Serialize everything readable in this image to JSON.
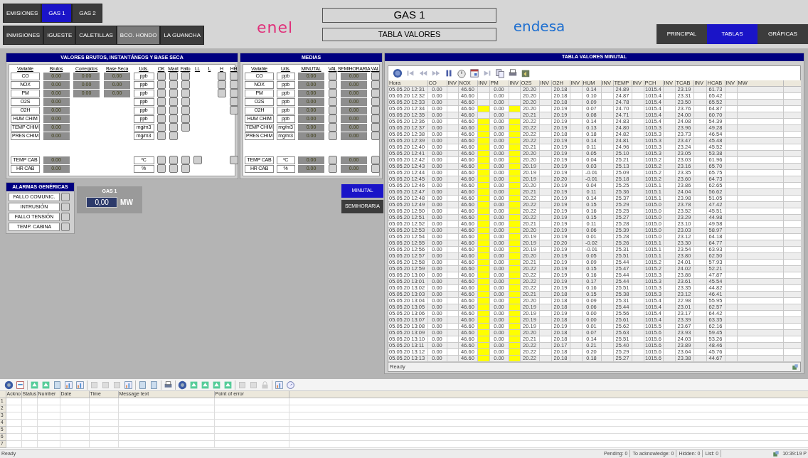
{
  "nav": {
    "row1": [
      {
        "label": "EMISIONES",
        "selected": false
      },
      {
        "label": "GAS 1",
        "selected": true
      },
      {
        "label": "GAS 2",
        "selected": false
      }
    ],
    "row2": [
      {
        "label": "INMISIONES",
        "selected": false
      },
      {
        "label": "IGUESTE",
        "selected": false
      },
      {
        "label": "CALETILLAS",
        "selected": false
      },
      {
        "label": "BCO. HONDO",
        "selected": true
      },
      {
        "label": "LA GUANCHA",
        "selected": false
      }
    ],
    "logo_left": "enel",
    "title": "GAS 1",
    "subtitle": "TABLA VALORES",
    "logo_right": "endesa",
    "right": [
      {
        "label": "PRINCIPAL",
        "selected": false
      },
      {
        "label": "TABLAS",
        "selected": true
      },
      {
        "label": "GRÁFICAS",
        "selected": false
      }
    ]
  },
  "raw_panel": {
    "title": "VALORES BRUTOS, INSTANTÁNEOS Y BASE SECA",
    "columns": [
      "Variable",
      "Brutos",
      "Corregidos",
      "Base Seca",
      "Uds.",
      "OK",
      "Mant",
      "Fallo",
      "LL",
      "L",
      "H",
      "HH"
    ],
    "rows": [
      {
        "variable": "CO",
        "brutos": "0.00",
        "corregidos": "0.00",
        "base_seca": "0.00",
        "units": "ppb",
        "boxes": [
          true,
          true,
          true,
          false,
          false,
          true,
          true
        ]
      },
      {
        "variable": "NOX",
        "brutos": "0.00",
        "corregidos": "0.00",
        "base_seca": "0.00",
        "units": "ppb",
        "boxes": [
          true,
          true,
          true,
          false,
          false,
          true,
          true
        ]
      },
      {
        "variable": "PM",
        "brutos": "0.00",
        "corregidos": "0.00",
        "base_seca": "0.00",
        "units": "ppb",
        "boxes": [
          true,
          true,
          true,
          false,
          false,
          true,
          true
        ]
      },
      {
        "variable": "O2S",
        "brutos": "0.00",
        "units": "ppb",
        "boxes": [
          true,
          true,
          true,
          false,
          false,
          false,
          true
        ]
      },
      {
        "variable": "O2H",
        "brutos": "0.00",
        "units": "ppb",
        "boxes": [
          true,
          true,
          true,
          false,
          false,
          false,
          true
        ]
      },
      {
        "variable": "HUM CHIM",
        "brutos": "0.00",
        "units": "ppb",
        "boxes": [
          true,
          true,
          true,
          false,
          false,
          false,
          false
        ]
      },
      {
        "variable": "TEMP CHIM",
        "brutos": "0.00",
        "units": "mg/m3",
        "boxes": [
          true,
          true,
          true,
          false,
          false,
          false,
          false
        ]
      },
      {
        "variable": "PRES CHIM",
        "brutos": "0.00",
        "units": "mg/m3",
        "boxes": [
          true,
          true,
          false,
          false,
          false,
          false,
          false
        ]
      }
    ],
    "cabin_rows": [
      {
        "variable": "TEMP CAB",
        "brutos": "0.00",
        "units": "ºC",
        "boxes": [
          true,
          true,
          true,
          true,
          false,
          false,
          true
        ]
      },
      {
        "variable": "HR CAB",
        "brutos": "0.00",
        "units": "%",
        "boxes": [
          true,
          true,
          true,
          false,
          false,
          false,
          false
        ]
      }
    ]
  },
  "medias_panel": {
    "title": "MEDIAS",
    "columns": [
      "Variable",
      "Uds.",
      "MINUTAL",
      "VAL",
      "SEMIHORARIA",
      "VAL"
    ],
    "rows": [
      {
        "variable": "CO",
        "units": "ppb",
        "minutal": "0.00",
        "semihoraria": "0.00"
      },
      {
        "variable": "NOX",
        "units": "ppb",
        "minutal": "0.00",
        "semihoraria": "0.00"
      },
      {
        "variable": "PM",
        "units": "ppb",
        "minutal": "0.00",
        "semihoraria": "0.00"
      },
      {
        "variable": "O2S",
        "units": "ppb",
        "minutal": "0.00",
        "semihoraria": "0.00"
      },
      {
        "variable": "O2H",
        "units": "ppb",
        "minutal": "0.00",
        "semihoraria": "0.00"
      },
      {
        "variable": "HUM CHIM",
        "units": "ppb",
        "minutal": "0.00",
        "semihoraria": "0.00"
      },
      {
        "variable": "TEMP CHIM",
        "units": "mg/m3",
        "minutal": "0.00",
        "semihoraria": "0.00"
      },
      {
        "variable": "PRES CHIM",
        "units": "mg/m3",
        "minutal": "0.00",
        "semihoraria": "0.00"
      }
    ],
    "cabin_rows": [
      {
        "variable": "TEMP CAB",
        "units": "ºC",
        "minutal": "0.00",
        "semihoraria": "0.00"
      },
      {
        "variable": "HR CAB",
        "units": "%",
        "minutal": "0.00",
        "semihoraria": "0.00"
      }
    ]
  },
  "alarms": {
    "title": "ALARMAS GENÉRICAS",
    "items": [
      "FALLO COMUNIC.",
      "INTRUSIÓN",
      "FALLO TENSIÓN",
      "TEMP. CABINA"
    ]
  },
  "power": {
    "title": "GAS 1",
    "value": "0,00",
    "unit": "MW"
  },
  "period_buttons": [
    {
      "label": "MINUTAL",
      "selected": true
    },
    {
      "label": "SEMIHORARIA",
      "selected": false
    }
  ],
  "table": {
    "title": "TABLA VALORES MINUTAL",
    "columns": [
      "Hora",
      "CO",
      "INV",
      "NOX",
      "INV",
      "PM",
      "INV",
      "O2S",
      "INV",
      "O2H",
      "INV",
      "HUM",
      "INV",
      "TEMP",
      "INV",
      "PCH",
      "INV",
      "TCAB",
      "INV",
      "HCAB",
      "INV",
      "MW"
    ],
    "rows": [
      {
        "cells": [
          "05.05.20 12:31",
          "0.00",
          "",
          "46.60",
          "",
          "0.00",
          "",
          "20.20",
          "",
          "20.18",
          "",
          "0.14",
          "",
          "24.89",
          "",
          "1015.4",
          "",
          "23.19",
          "",
          "61.73",
          "",
          ""
        ],
        "nox_inv": false,
        "pm_inv": false
      },
      {
        "cells": [
          "05.05.20 12:32",
          "0.00",
          "",
          "46.60",
          "",
          "0.00",
          "",
          "20.20",
          "",
          "20.18",
          "",
          "0.10",
          "",
          "24.87",
          "",
          "1015.4",
          "",
          "23.31",
          "",
          "65.42",
          "",
          ""
        ],
        "nox_inv": false,
        "pm_inv": false
      },
      {
        "cells": [
          "05.05.20 12:33",
          "0.00",
          "",
          "46.60",
          "",
          "0.00",
          "",
          "20.20",
          "",
          "20.18",
          "",
          "0.09",
          "",
          "24.78",
          "",
          "1015.4",
          "",
          "23.50",
          "",
          "65.52",
          "",
          ""
        ],
        "nox_inv": false,
        "pm_inv": false
      },
      {
        "cells": [
          "05.05.20 12:34",
          "0.00",
          "",
          "46.60",
          "",
          "0.00",
          "",
          "20.20",
          "",
          "20.19",
          "",
          "0.07",
          "",
          "24.70",
          "",
          "1015.4",
          "",
          "23.76",
          "",
          "64.87",
          "",
          ""
        ],
        "nox_inv": true,
        "pm_inv": true
      },
      {
        "cells": [
          "05.05.20 12:35",
          "0.00",
          "",
          "46.60",
          "",
          "0.00",
          "",
          "20.21",
          "",
          "20.19",
          "",
          "0.08",
          "",
          "24.71",
          "",
          "1015.4",
          "",
          "24.00",
          "",
          "60.70",
          "",
          ""
        ],
        "nox_inv": false,
        "pm_inv": false
      },
      {
        "cells": [
          "05.05.20 12:36",
          "0.00",
          "",
          "46.60",
          "",
          "0.00",
          "",
          "20.22",
          "",
          "20.19",
          "",
          "0.14",
          "",
          "24.83",
          "",
          "1015.4",
          "",
          "24.08",
          "",
          "54.39",
          "",
          ""
        ],
        "nox_inv": true,
        "pm_inv": true
      },
      {
        "cells": [
          "05.05.20 12:37",
          "0.00",
          "",
          "46.60",
          "",
          "0.00",
          "",
          "20.22",
          "",
          "20.19",
          "",
          "0.13",
          "",
          "24.80",
          "",
          "1015.3",
          "",
          "23.96",
          "",
          "49.28",
          "",
          ""
        ],
        "nox_inv": true,
        "pm_inv": true
      },
      {
        "cells": [
          "05.05.20 12:38",
          "0.00",
          "",
          "46.60",
          "",
          "0.00",
          "",
          "20.22",
          "",
          "20.18",
          "",
          "0.18",
          "",
          "24.82",
          "",
          "1015.3",
          "",
          "23.73",
          "",
          "46.54",
          "",
          ""
        ],
        "nox_inv": true,
        "pm_inv": true
      },
      {
        "cells": [
          "05.05.20 12:39",
          "0.00",
          "",
          "46.60",
          "",
          "0.00",
          "",
          "20.22",
          "",
          "20.19",
          "",
          "0.14",
          "",
          "24.81",
          "",
          "1015.3",
          "",
          "23.47",
          "",
          "45.48",
          "",
          ""
        ],
        "nox_inv": true,
        "pm_inv": true
      },
      {
        "cells": [
          "05.05.20 12:40",
          "0.00",
          "",
          "46.60",
          "",
          "0.00",
          "",
          "20.21",
          "",
          "20.19",
          "",
          "0.11",
          "",
          "24.96",
          "",
          "1015.3",
          "",
          "23.24",
          "",
          "45.52",
          "",
          ""
        ],
        "nox_inv": true,
        "pm_inv": true
      },
      {
        "cells": [
          "05.05.20 12:41",
          "0.00",
          "",
          "46.60",
          "",
          "0.00",
          "",
          "20.20",
          "",
          "20.19",
          "",
          "0.05",
          "",
          "25.10",
          "",
          "1015.3",
          "",
          "23.05",
          "",
          "53.38",
          "",
          ""
        ],
        "nox_inv": true,
        "pm_inv": true
      },
      {
        "cells": [
          "05.05.20 12:42",
          "0.00",
          "",
          "46.60",
          "",
          "0.00",
          "",
          "20.20",
          "",
          "20.19",
          "",
          "0.04",
          "",
          "25.21",
          "",
          "1015.2",
          "",
          "23.03",
          "",
          "61.96",
          "",
          ""
        ],
        "nox_inv": true,
        "pm_inv": true
      },
      {
        "cells": [
          "05.05.20 12:43",
          "0.00",
          "",
          "46.60",
          "",
          "0.00",
          "",
          "20.19",
          "",
          "20.19",
          "",
          "0.03",
          "",
          "25.13",
          "",
          "1015.2",
          "",
          "23.16",
          "",
          "65.70",
          "",
          ""
        ],
        "nox_inv": true,
        "pm_inv": true
      },
      {
        "cells": [
          "05.05.20 12:44",
          "0.00",
          "",
          "46.60",
          "",
          "0.00",
          "",
          "20.19",
          "",
          "20.19",
          "",
          "-0.01",
          "",
          "25.09",
          "",
          "1015.2",
          "",
          "23.35",
          "",
          "65.75",
          "",
          ""
        ],
        "nox_inv": true,
        "pm_inv": true
      },
      {
        "cells": [
          "05.05.20 12:45",
          "0.00",
          "",
          "46.60",
          "",
          "0.00",
          "",
          "20.19",
          "",
          "20.20",
          "",
          "-0.01",
          "",
          "25.18",
          "",
          "1015.2",
          "",
          "23.60",
          "",
          "64.73",
          "",
          ""
        ],
        "nox_inv": true,
        "pm_inv": true
      },
      {
        "cells": [
          "05.05.20 12:46",
          "0.00",
          "",
          "46.60",
          "",
          "0.00",
          "",
          "20.20",
          "",
          "20.19",
          "",
          "0.04",
          "",
          "25.25",
          "",
          "1015.1",
          "",
          "23.86",
          "",
          "62.65",
          "",
          ""
        ],
        "nox_inv": true,
        "pm_inv": true
      },
      {
        "cells": [
          "05.05.20 12:47",
          "0.00",
          "",
          "46.60",
          "",
          "0.00",
          "",
          "20.21",
          "",
          "20.19",
          "",
          "0.11",
          "",
          "25.36",
          "",
          "1015.1",
          "",
          "24.04",
          "",
          "56.62",
          "",
          ""
        ],
        "nox_inv": true,
        "pm_inv": true
      },
      {
        "cells": [
          "05.05.20 12:48",
          "0.00",
          "",
          "46.60",
          "",
          "0.00",
          "",
          "20.22",
          "",
          "20.19",
          "",
          "0.14",
          "",
          "25.37",
          "",
          "1015.1",
          "",
          "23.98",
          "",
          "51.05",
          "",
          ""
        ],
        "nox_inv": true,
        "pm_inv": true
      },
      {
        "cells": [
          "05.05.20 12:49",
          "0.00",
          "",
          "46.60",
          "",
          "0.00",
          "",
          "20.22",
          "",
          "20.19",
          "",
          "0.15",
          "",
          "25.29",
          "",
          "1015.0",
          "",
          "23.78",
          "",
          "47.42",
          "",
          ""
        ],
        "nox_inv": true,
        "pm_inv": true
      },
      {
        "cells": [
          "05.05.20 12:50",
          "0.00",
          "",
          "46.60",
          "",
          "0.00",
          "",
          "20.22",
          "",
          "20.19",
          "",
          "0.16",
          "",
          "25.25",
          "",
          "1015.0",
          "",
          "23.52",
          "",
          "45.51",
          "",
          ""
        ],
        "nox_inv": true,
        "pm_inv": true
      },
      {
        "cells": [
          "05.05.20 12:51",
          "0.00",
          "",
          "46.60",
          "",
          "0.00",
          "",
          "20.22",
          "",
          "20.19",
          "",
          "0.15",
          "",
          "25.27",
          "",
          "1015.0",
          "",
          "23.29",
          "",
          "44.98",
          "",
          ""
        ],
        "nox_inv": true,
        "pm_inv": true
      },
      {
        "cells": [
          "05.05.20 12:52",
          "0.00",
          "",
          "46.60",
          "",
          "0.00",
          "",
          "20.21",
          "",
          "20.19",
          "",
          "0.11",
          "",
          "25.28",
          "",
          "1015.0",
          "",
          "23.10",
          "",
          "49.58",
          "",
          ""
        ],
        "nox_inv": true,
        "pm_inv": true
      },
      {
        "cells": [
          "05.05.20 12:53",
          "0.00",
          "",
          "46.60",
          "",
          "0.00",
          "",
          "20.20",
          "",
          "20.19",
          "",
          "0.06",
          "",
          "25.39",
          "",
          "1015.0",
          "",
          "23.03",
          "",
          "58.97",
          "",
          ""
        ],
        "nox_inv": true,
        "pm_inv": true
      },
      {
        "cells": [
          "05.05.20 12:54",
          "0.00",
          "",
          "46.60",
          "",
          "0.00",
          "",
          "20.19",
          "",
          "20.19",
          "",
          "0.01",
          "",
          "25.28",
          "",
          "1015.0",
          "",
          "23.12",
          "",
          "64.18",
          "",
          ""
        ],
        "nox_inv": true,
        "pm_inv": true
      },
      {
        "cells": [
          "05.05.20 12:55",
          "0.00",
          "",
          "46.60",
          "",
          "0.00",
          "",
          "20.19",
          "",
          "20.20",
          "",
          "-0.02",
          "",
          "25.26",
          "",
          "1015.1",
          "",
          "23.30",
          "",
          "64.77",
          "",
          ""
        ],
        "nox_inv": true,
        "pm_inv": true
      },
      {
        "cells": [
          "05.05.20 12:56",
          "0.00",
          "",
          "46.60",
          "",
          "0.00",
          "",
          "20.19",
          "",
          "20.19",
          "",
          "-0.01",
          "",
          "25.31",
          "",
          "1015.1",
          "",
          "23.54",
          "",
          "63.93",
          "",
          ""
        ],
        "nox_inv": true,
        "pm_inv": true
      },
      {
        "cells": [
          "05.05.20 12:57",
          "0.00",
          "",
          "46.60",
          "",
          "0.00",
          "",
          "20.20",
          "",
          "20.19",
          "",
          "0.05",
          "",
          "25.51",
          "",
          "1015.1",
          "",
          "23.80",
          "",
          "62.50",
          "",
          ""
        ],
        "nox_inv": true,
        "pm_inv": true
      },
      {
        "cells": [
          "05.05.20 12:58",
          "0.00",
          "",
          "46.60",
          "",
          "0.00",
          "",
          "20.21",
          "",
          "20.19",
          "",
          "0.09",
          "",
          "25.44",
          "",
          "1015.2",
          "",
          "24.01",
          "",
          "57.93",
          "",
          ""
        ],
        "nox_inv": true,
        "pm_inv": true
      },
      {
        "cells": [
          "05.05.20 12:59",
          "0.00",
          "",
          "46.60",
          "",
          "0.00",
          "",
          "20.22",
          "",
          "20.19",
          "",
          "0.15",
          "",
          "25.47",
          "",
          "1015.2",
          "",
          "24.02",
          "",
          "52.21",
          "",
          ""
        ],
        "nox_inv": true,
        "pm_inv": true
      },
      {
        "cells": [
          "05.05.20 13:00",
          "0.00",
          "",
          "46.60",
          "",
          "0.00",
          "",
          "20.22",
          "",
          "20.19",
          "",
          "0.16",
          "",
          "25.44",
          "",
          "1015.3",
          "",
          "23.86",
          "",
          "47.87",
          "",
          ""
        ],
        "nox_inv": true,
        "pm_inv": true
      },
      {
        "cells": [
          "05.05.20 13:01",
          "0.00",
          "",
          "46.60",
          "",
          "0.00",
          "",
          "20.22",
          "",
          "20.19",
          "",
          "0.17",
          "",
          "25.44",
          "",
          "1015.3",
          "",
          "23.61",
          "",
          "45.54",
          "",
          ""
        ],
        "nox_inv": true,
        "pm_inv": true
      },
      {
        "cells": [
          "05.05.20 13:02",
          "0.00",
          "",
          "46.60",
          "",
          "0.00",
          "",
          "20.22",
          "",
          "20.19",
          "",
          "0.16",
          "",
          "25.51",
          "",
          "1015.3",
          "",
          "23.35",
          "",
          "44.82",
          "",
          ""
        ],
        "nox_inv": true,
        "pm_inv": true
      },
      {
        "cells": [
          "05.05.20 13:03",
          "0.00",
          "",
          "46.60",
          "",
          "0.00",
          "",
          "20.21",
          "",
          "20.18",
          "",
          "0.15",
          "",
          "25.38",
          "",
          "1015.3",
          "",
          "23.12",
          "",
          "46.41",
          "",
          ""
        ],
        "nox_inv": true,
        "pm_inv": true
      },
      {
        "cells": [
          "05.05.20 13:04",
          "0.00",
          "",
          "46.60",
          "",
          "0.00",
          "",
          "20.20",
          "",
          "20.18",
          "",
          "0.09",
          "",
          "25.31",
          "",
          "1015.4",
          "",
          "22.98",
          "",
          "55.95",
          "",
          ""
        ],
        "nox_inv": true,
        "pm_inv": true
      },
      {
        "cells": [
          "05.05.20 13:05",
          "0.00",
          "",
          "46.60",
          "",
          "0.00",
          "",
          "20.19",
          "",
          "20.18",
          "",
          "0.06",
          "",
          "25.44",
          "",
          "1015.4",
          "",
          "23.01",
          "",
          "62.57",
          "",
          ""
        ],
        "nox_inv": true,
        "pm_inv": true
      },
      {
        "cells": [
          "05.05.20 13:06",
          "0.00",
          "",
          "46.60",
          "",
          "0.00",
          "",
          "20.19",
          "",
          "20.19",
          "",
          "0.00",
          "",
          "25.56",
          "",
          "1015.4",
          "",
          "23.17",
          "",
          "64.42",
          "",
          ""
        ],
        "nox_inv": true,
        "pm_inv": true
      },
      {
        "cells": [
          "05.05.20 13:07",
          "0.00",
          "",
          "46.60",
          "",
          "0.00",
          "",
          "20.19",
          "",
          "20.18",
          "",
          "0.00",
          "",
          "25.61",
          "",
          "1015.4",
          "",
          "23.39",
          "",
          "63.35",
          "",
          ""
        ],
        "nox_inv": true,
        "pm_inv": true
      },
      {
        "cells": [
          "05.05.20 13:08",
          "0.00",
          "",
          "46.60",
          "",
          "0.00",
          "",
          "20.19",
          "",
          "20.19",
          "",
          "0.01",
          "",
          "25.62",
          "",
          "1015.5",
          "",
          "23.67",
          "",
          "62.16",
          "",
          ""
        ],
        "nox_inv": true,
        "pm_inv": true
      },
      {
        "cells": [
          "05.05.20 13:09",
          "0.00",
          "",
          "46.60",
          "",
          "0.00",
          "",
          "20.20",
          "",
          "20.18",
          "",
          "0.07",
          "",
          "25.63",
          "",
          "1015.6",
          "",
          "23.93",
          "",
          "59.45",
          "",
          ""
        ],
        "nox_inv": true,
        "pm_inv": true
      },
      {
        "cells": [
          "05.05.20 13:10",
          "0.00",
          "",
          "46.60",
          "",
          "0.00",
          "",
          "20.21",
          "",
          "20.18",
          "",
          "0.14",
          "",
          "25.51",
          "",
          "1015.6",
          "",
          "24.03",
          "",
          "53.26",
          "",
          ""
        ],
        "nox_inv": true,
        "pm_inv": true
      },
      {
        "cells": [
          "05.05.20 13:11",
          "0.00",
          "",
          "46.60",
          "",
          "0.00",
          "",
          "20.22",
          "",
          "20.17",
          "",
          "0.21",
          "",
          "25.40",
          "",
          "1015.6",
          "",
          "23.89",
          "",
          "48.46",
          "",
          ""
        ],
        "nox_inv": true,
        "pm_inv": true
      },
      {
        "cells": [
          "05.05.20 13:12",
          "0.00",
          "",
          "46.60",
          "",
          "0.00",
          "",
          "20.22",
          "",
          "20.18",
          "",
          "0.20",
          "",
          "25.29",
          "",
          "1015.6",
          "",
          "23.64",
          "",
          "45.76",
          "",
          ""
        ],
        "nox_inv": true,
        "pm_inv": true
      },
      {
        "cells": [
          "05.05.20 13:13",
          "0.00",
          "",
          "46.60",
          "",
          "0.00",
          "",
          "20.22",
          "",
          "20.18",
          "",
          "0.18",
          "",
          "25.27",
          "",
          "1015.6",
          "",
          "23.38",
          "",
          "44.67",
          "",
          ""
        ],
        "nox_inv": true,
        "pm_inv": true
      }
    ],
    "status": "Ready"
  },
  "alarm_view": {
    "columns": [
      "Ackno",
      "Status",
      "Number",
      "Date",
      "Time",
      "Message text",
      "Point of error"
    ],
    "row_numbers": [
      "1",
      "2",
      "3",
      "4",
      "5",
      "6",
      "7"
    ]
  },
  "status_bar": {
    "left": "Ready",
    "pending": "Pending: 0",
    "to_acknowledge": "To acknowledge: 0",
    "hidden": "Hidden: 0",
    "list": "List: 0",
    "time": "10:39:19 P"
  }
}
